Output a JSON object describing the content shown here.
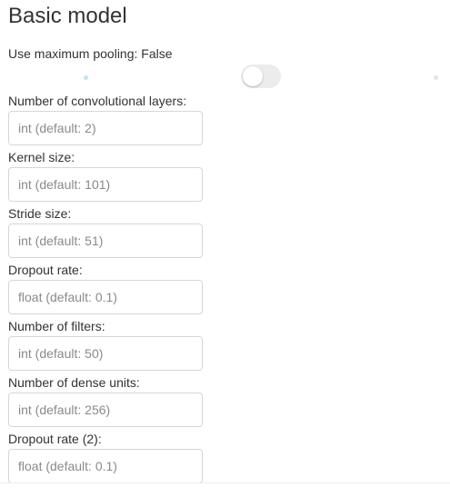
{
  "title": "Basic model",
  "max_pooling": {
    "label": "Use maximum pooling: False",
    "value": false
  },
  "fields": [
    {
      "label": "Number of convolutional layers:",
      "placeholder": "int (default: 2)",
      "value": ""
    },
    {
      "label": "Kernel size:",
      "placeholder": "int (default: 101)",
      "value": ""
    },
    {
      "label": "Stride size:",
      "placeholder": "int (default: 51)",
      "value": ""
    },
    {
      "label": "Dropout rate:",
      "placeholder": "float (default: 0.1)",
      "value": ""
    },
    {
      "label": "Number of filters:",
      "placeholder": "int (default: 50)",
      "value": ""
    },
    {
      "label": "Number of dense units:",
      "placeholder": "int (default: 256)",
      "value": ""
    },
    {
      "label": "Dropout rate (2):",
      "placeholder": "float (default: 0.1)",
      "value": ""
    }
  ],
  "colors": {
    "text": "#333333",
    "placeholder": "#8a8a8a",
    "input_border": "#d6d6d6",
    "toggle_off": "#ececec"
  }
}
